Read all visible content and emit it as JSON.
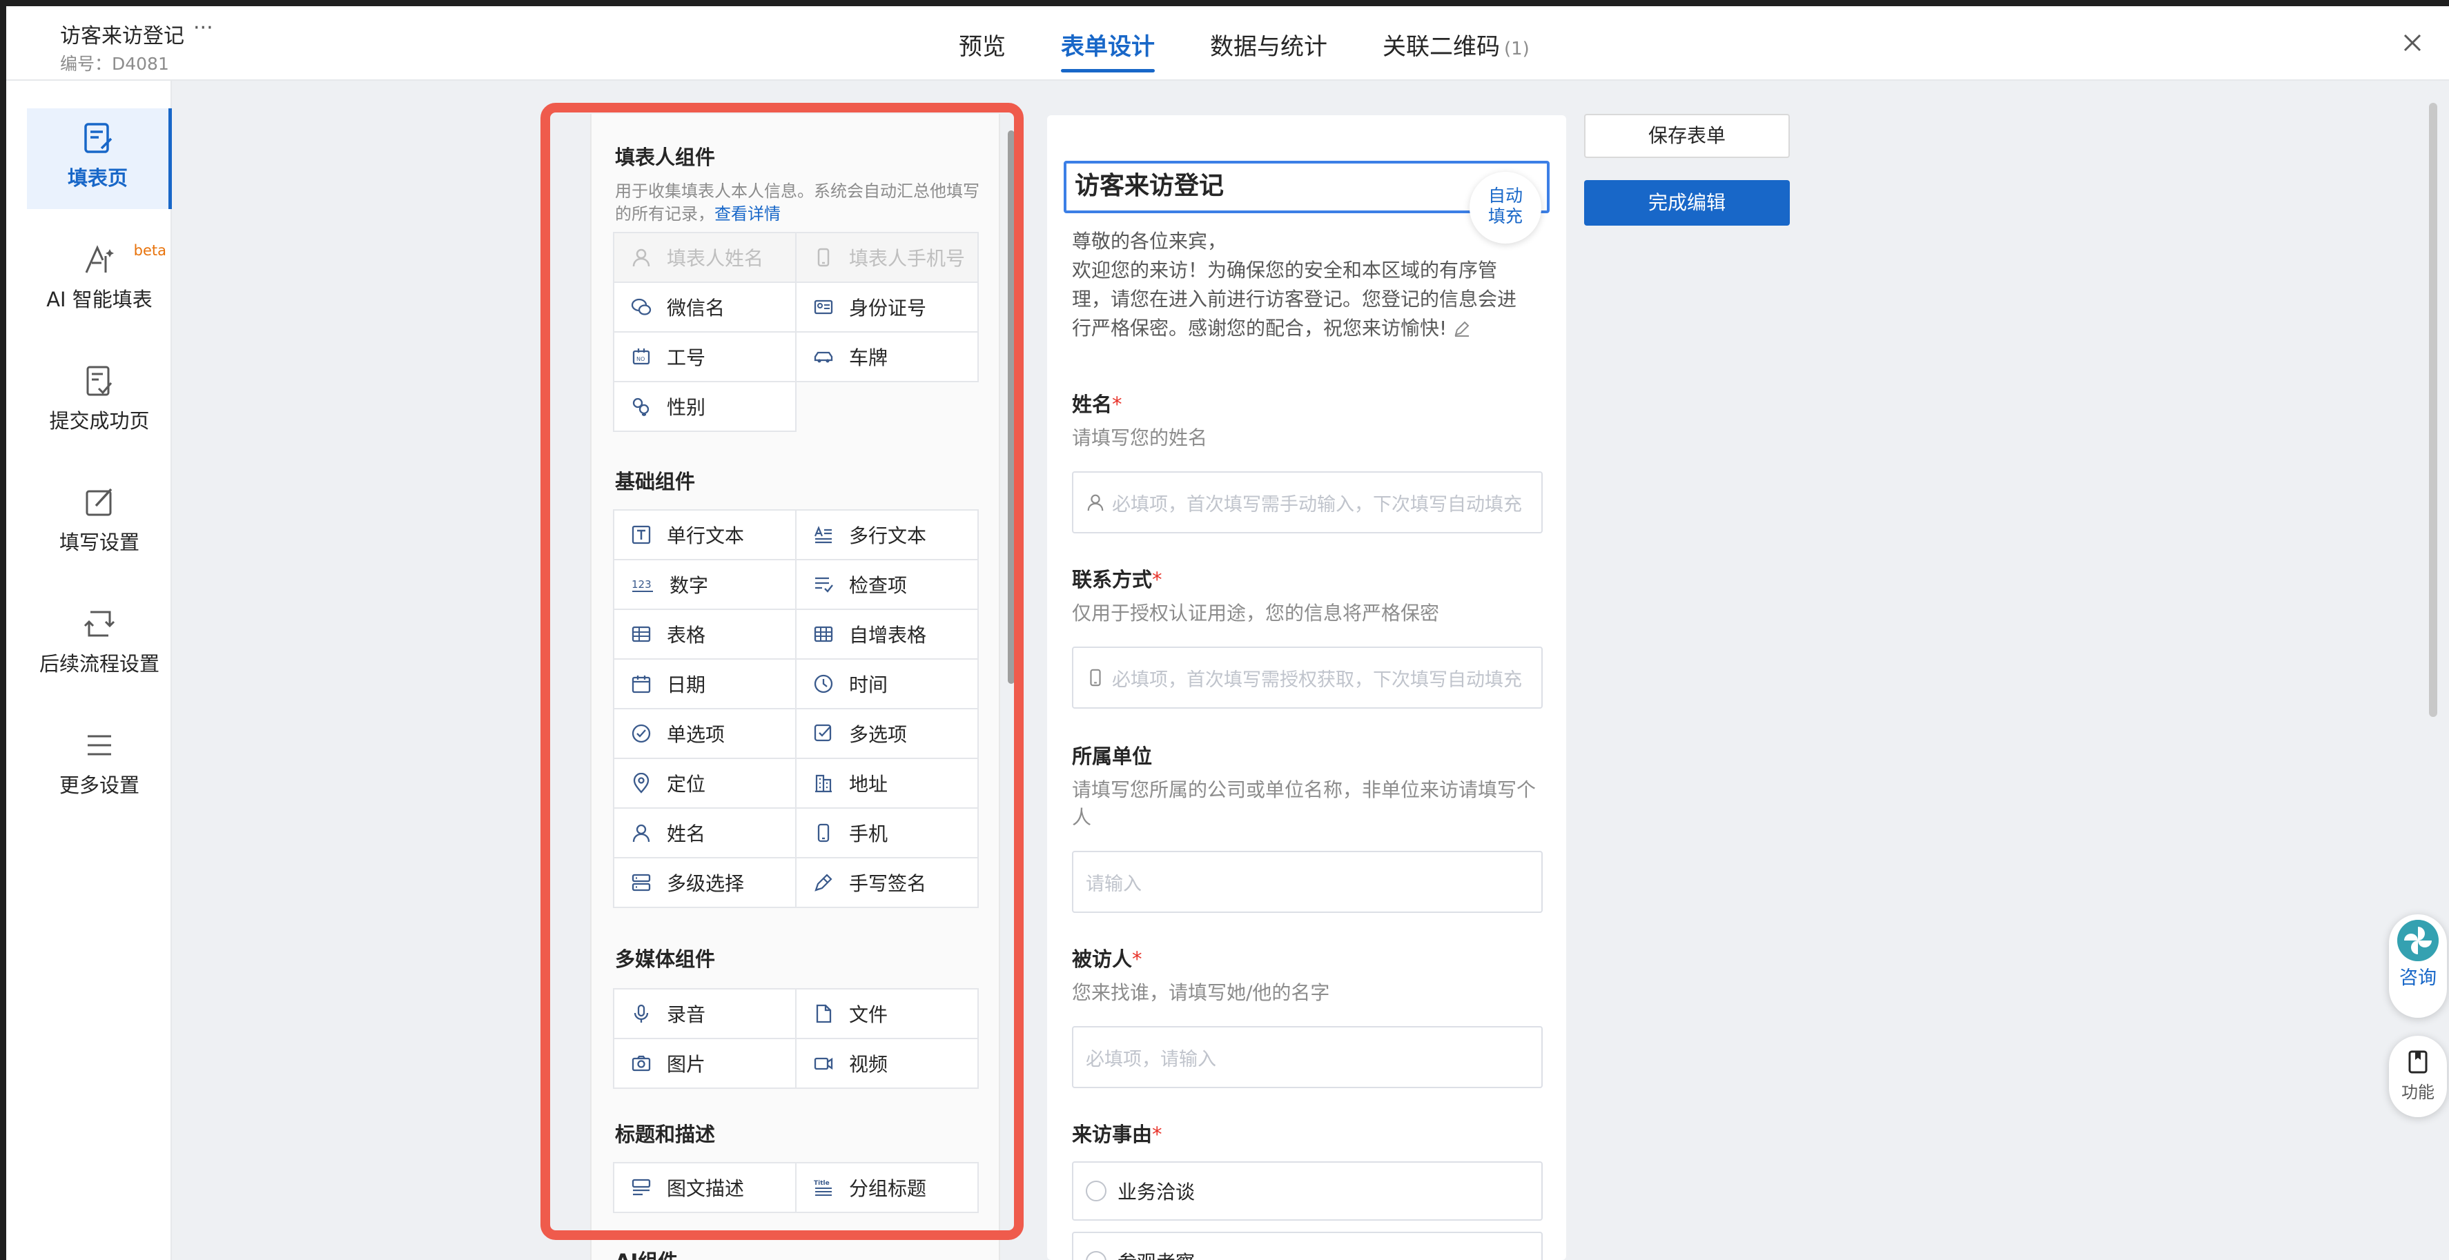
{
  "header": {
    "form_title": "访客来访登记",
    "more_glyph": "···",
    "form_id": "编号：D4081",
    "tabs": [
      {
        "label": "预览",
        "active": false
      },
      {
        "label": "表单设计",
        "active": true
      },
      {
        "label": "数据与统计",
        "active": false
      },
      {
        "label": "关联二维码",
        "count": "(1)",
        "active": false
      }
    ]
  },
  "left_nav": {
    "items": [
      {
        "label": "填表页",
        "icon": "form-page-icon",
        "active": true
      },
      {
        "label": "AI 智能填表",
        "icon": "ai-fill-icon",
        "badge": "beta"
      },
      {
        "label": "提交成功页",
        "icon": "submit-success-icon"
      },
      {
        "label": "填写设置",
        "icon": "edit-settings-icon"
      },
      {
        "label": "后续流程设置",
        "icon": "workflow-icon"
      },
      {
        "label": "更多设置",
        "icon": "menu-lines-icon"
      }
    ]
  },
  "components": {
    "filler": {
      "title": "填表人组件",
      "desc": "用于收集填表人本人信息。系统会自动汇总他填写的所有记录，",
      "link": "查看详情",
      "items": [
        {
          "label": "填表人姓名",
          "icon": "person-icon",
          "disabled": true
        },
        {
          "label": "填表人手机号",
          "icon": "phone-icon",
          "disabled": true
        },
        {
          "label": "微信名",
          "icon": "wechat-icon"
        },
        {
          "label": "身份证号",
          "icon": "id-card-icon"
        },
        {
          "label": "工号",
          "icon": "employee-no-icon"
        },
        {
          "label": "车牌",
          "icon": "car-icon"
        },
        {
          "label": "性别",
          "icon": "gender-icon"
        }
      ]
    },
    "basic": {
      "title": "基础组件",
      "items": [
        {
          "label": "单行文本",
          "icon": "text-t-icon"
        },
        {
          "label": "多行文本",
          "icon": "multiline-text-icon"
        },
        {
          "label": "数字",
          "icon": "number-123-icon"
        },
        {
          "label": "检查项",
          "icon": "checklist-icon"
        },
        {
          "label": "表格",
          "icon": "table-icon"
        },
        {
          "label": "自增表格",
          "icon": "auto-table-icon"
        },
        {
          "label": "日期",
          "icon": "calendar-icon"
        },
        {
          "label": "时间",
          "icon": "clock-icon"
        },
        {
          "label": "单选项",
          "icon": "radio-check-icon"
        },
        {
          "label": "多选项",
          "icon": "checkbox-icon"
        },
        {
          "label": "定位",
          "icon": "location-pin-icon"
        },
        {
          "label": "地址",
          "icon": "address-icon"
        },
        {
          "label": "姓名",
          "icon": "person-icon"
        },
        {
          "label": "手机",
          "icon": "phone-icon"
        },
        {
          "label": "多级选择",
          "icon": "cascade-icon"
        },
        {
          "label": "手写签名",
          "icon": "pen-sign-icon"
        }
      ]
    },
    "media": {
      "title": "多媒体组件",
      "items": [
        {
          "label": "录音",
          "icon": "microphone-icon"
        },
        {
          "label": "文件",
          "icon": "file-icon"
        },
        {
          "label": "图片",
          "icon": "camera-icon"
        },
        {
          "label": "视频",
          "icon": "video-icon"
        }
      ]
    },
    "heading": {
      "title": "标题和描述",
      "items": [
        {
          "label": "图文描述",
          "icon": "image-text-icon"
        },
        {
          "label": "分组标题",
          "icon": "title-icon"
        }
      ]
    },
    "ai": {
      "title": "AI组件"
    }
  },
  "form": {
    "title": "访客来访登记",
    "autofill": "自动\n填充",
    "intro": "尊敬的各位来宾，\n欢迎您的来访！为确保您的安全和本区域的有序管理，请您在进入前进行访客登记。您登记的信息会进行严格保密。感谢您的配合，祝您来访愉快!",
    "questions": [
      {
        "label": "姓名",
        "required": "*",
        "desc": "请填写您的姓名",
        "placeholder": "必填项，首次填写需手动输入，下次填写自动填充",
        "icon": "person-icon"
      },
      {
        "label": "联系方式",
        "required": "*",
        "desc": "仅用于授权认证用途，您的信息将严格保密",
        "placeholder": "必填项，首次填写需授权获取，下次填写自动填充",
        "icon": "phone-icon"
      },
      {
        "label": "所属单位",
        "required": "",
        "desc": "请填写您所属的公司或单位名称，非单位来访请填写个人",
        "placeholder": "请输入"
      },
      {
        "label": "被访人",
        "required": "*",
        "desc": "您来找谁，请填写她/他的名字",
        "placeholder": "必填项，请输入"
      },
      {
        "label": "来访事由",
        "required": "*",
        "options": [
          "业务洽谈",
          "参观考察"
        ]
      }
    ]
  },
  "actions": {
    "save": "保存表单",
    "done": "完成编辑"
  },
  "floating": {
    "consult": "咨询",
    "function": "功能"
  },
  "colors": {
    "accent": "#1867c8",
    "highlight": "#ef5b4c",
    "required": "#e8332a"
  }
}
